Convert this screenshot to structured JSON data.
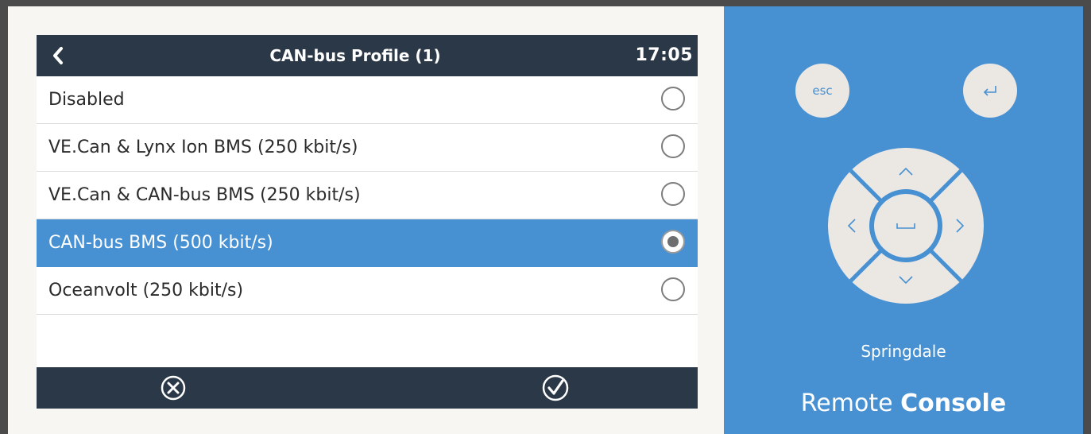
{
  "header": {
    "title": "CAN-bus Profile (1)",
    "clock": "17:05"
  },
  "options": [
    {
      "label": "Disabled",
      "selected": false
    },
    {
      "label": "VE.Can & Lynx Ion BMS (250 kbit/s)",
      "selected": false
    },
    {
      "label": "VE.Can & CAN-bus BMS (250 kbit/s)",
      "selected": false
    },
    {
      "label": "CAN-bus BMS (500 kbit/s)",
      "selected": true
    },
    {
      "label": "Oceanvolt (250 kbit/s)",
      "selected": false
    }
  ],
  "remote": {
    "esc_label": "esc",
    "site_name": "Springdale",
    "brand_regular": "Remote ",
    "brand_bold": "Console"
  },
  "icons": {
    "back": "chevron-left-icon",
    "cancel": "circle-x-icon",
    "ok": "circle-check-icon",
    "enter": "enter-return-icon",
    "up": "chevron-up-icon",
    "down": "chevron-down-icon",
    "left": "chevron-left-icon",
    "right": "chevron-right-icon",
    "space": "space-icon"
  },
  "colors": {
    "bar": "#2b3847",
    "accent": "#4790d2",
    "button": "#ebe8e4"
  }
}
